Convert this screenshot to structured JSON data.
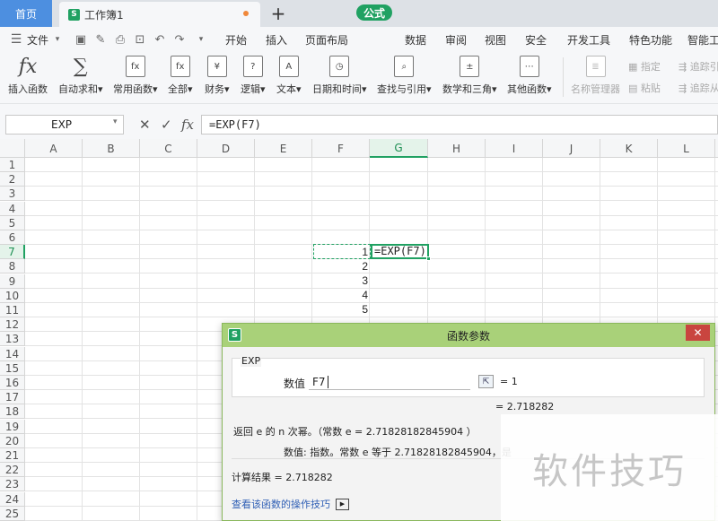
{
  "titlebar": {
    "home_tab": "首页",
    "doc_tab": "工作簿1",
    "doc_logo": "S",
    "new_tab": "+"
  },
  "menubar": {
    "file_label": "文件",
    "items": [
      "开始",
      "插入",
      "页面布局",
      "公式",
      "数据",
      "审阅",
      "视图",
      "安全",
      "开发工具",
      "特色功能",
      "智能工"
    ],
    "active": "公式"
  },
  "ribbon": {
    "buttons": [
      {
        "label": "插入函数",
        "icon": "fx-icon",
        "glyph": "fx"
      },
      {
        "label": "自动求和▾",
        "icon": "sigma-icon",
        "glyph": "∑"
      },
      {
        "label": "常用函数▾",
        "icon": "star-function-icon",
        "glyph": "fx"
      },
      {
        "label": "全部▾",
        "icon": "all-functions-icon",
        "glyph": "fx"
      },
      {
        "label": "财务▾",
        "icon": "finance-icon",
        "glyph": "¥"
      },
      {
        "label": "逻辑▾",
        "icon": "logic-icon",
        "glyph": "?"
      },
      {
        "label": "文本▾",
        "icon": "text-icon",
        "glyph": "A"
      },
      {
        "label": "日期和时间▾",
        "icon": "clock-icon",
        "glyph": "◷"
      },
      {
        "label": "查找与引用▾",
        "icon": "lookup-icon",
        "glyph": "⌕"
      },
      {
        "label": "数学和三角▾",
        "icon": "math-icon",
        "glyph": "±"
      },
      {
        "label": "其他函数▾",
        "icon": "more-functions-icon",
        "glyph": "⋯"
      }
    ],
    "name_manager": "名称管理器",
    "define": "指定",
    "paste": "粘贴",
    "trace_precedents": "追踪引",
    "trace_dependents": "追踪从"
  },
  "formula_bar": {
    "name_box": "EXP",
    "cancel": "✕",
    "confirm": "✓",
    "fx": "fx",
    "formula": "=EXP(F7)"
  },
  "grid": {
    "columns": [
      "A",
      "B",
      "C",
      "D",
      "E",
      "F",
      "G",
      "H",
      "I",
      "J",
      "K",
      "L"
    ],
    "active_column": "G",
    "rows": [
      "1",
      "2",
      "3",
      "4",
      "5",
      "6",
      "7",
      "8",
      "9",
      "10",
      "11",
      "12",
      "13",
      "14",
      "15",
      "16",
      "17",
      "18",
      "19",
      "20",
      "21",
      "22",
      "23",
      "24",
      "25"
    ],
    "active_row": "7",
    "f_values": [
      "1",
      "2",
      "3",
      "4",
      "5"
    ],
    "g7": "=EXP(F7)"
  },
  "dialog": {
    "title": "函数参数",
    "logo": "S",
    "close": "✕",
    "function_name": "EXP",
    "param_label": "数值",
    "param_value": "F7",
    "param_eq": "=  1",
    "result_preview": "=  2.718282",
    "description": "返回 e 的 n 次幂。（常数 e = 2.71828182845904 ）",
    "param_description": "数值:  指数。常数 e 等于 2.71828182845904，是",
    "calc_result": "计算结果  =  2.718282",
    "help_link": "查看该函数的操作技巧",
    "help_icon": "▶"
  },
  "watermark": "软件技巧",
  "colors": {
    "accent": "#20a162",
    "dialog_title": "#a9d179",
    "close": "#c9453f",
    "home_tab": "#4d8fe0"
  }
}
